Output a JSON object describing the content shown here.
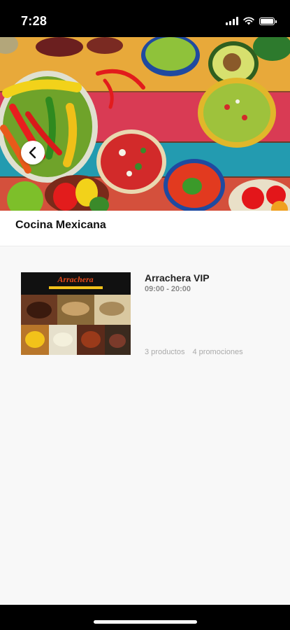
{
  "status": {
    "time": "7:28"
  },
  "header": {
    "title": "Cocina Mexicana"
  },
  "restaurants": [
    {
      "name": "Arrachera VIP",
      "hours": "09:00 - 20:00",
      "products": "3 productos",
      "promotions": "4 promociones",
      "logo_text": "Arrachera"
    }
  ],
  "icons": {
    "back": "chevron-left-icon"
  },
  "colors": {
    "background": "#f8f8f8",
    "header": "#ffffff",
    "status_bar": "#000000"
  }
}
